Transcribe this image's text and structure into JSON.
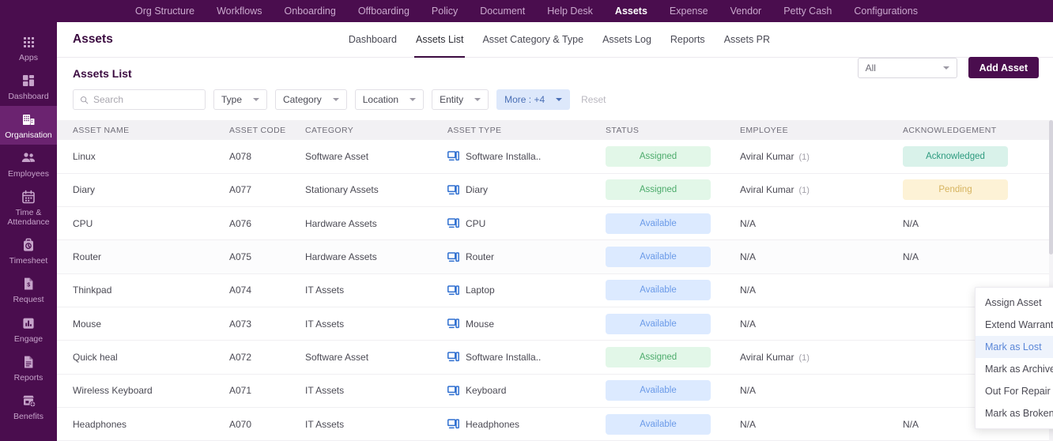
{
  "topnav": {
    "items": [
      {
        "label": "Org Structure",
        "active": false
      },
      {
        "label": "Workflows",
        "active": false
      },
      {
        "label": "Onboarding",
        "active": false
      },
      {
        "label": "Offboarding",
        "active": false
      },
      {
        "label": "Policy",
        "active": false
      },
      {
        "label": "Document",
        "active": false
      },
      {
        "label": "Help Desk",
        "active": false
      },
      {
        "label": "Assets",
        "active": true
      },
      {
        "label": "Expense",
        "active": false
      },
      {
        "label": "Vendor",
        "active": false
      },
      {
        "label": "Petty Cash",
        "active": false
      },
      {
        "label": "Configurations",
        "active": false
      }
    ]
  },
  "sidebar": {
    "items": [
      {
        "label": "Apps",
        "icon": "grid-icon",
        "active": false
      },
      {
        "label": "Dashboard",
        "icon": "dashboard-icon",
        "active": false
      },
      {
        "label": "Organisation",
        "icon": "building-icon",
        "active": true
      },
      {
        "label": "Employees",
        "icon": "people-icon",
        "active": false
      },
      {
        "label": "Time & Attendance",
        "icon": "calendar-icon",
        "active": false
      },
      {
        "label": "Timesheet",
        "icon": "clock-bag-icon",
        "active": false
      },
      {
        "label": "Request",
        "icon": "money-doc-icon",
        "active": false
      },
      {
        "label": "Engage",
        "icon": "bar-chart-icon",
        "active": false
      },
      {
        "label": "Reports",
        "icon": "document-icon",
        "active": false
      },
      {
        "label": "Benefits",
        "icon": "store-plus-icon",
        "active": false
      }
    ]
  },
  "header": {
    "title": "Assets",
    "subnav": [
      {
        "label": "Dashboard",
        "active": false
      },
      {
        "label": "Assets List",
        "active": true
      },
      {
        "label": "Asset Category & Type",
        "active": false
      },
      {
        "label": "Assets Log",
        "active": false
      },
      {
        "label": "Reports",
        "active": false
      },
      {
        "label": "Assets PR",
        "active": false
      }
    ]
  },
  "toolbar": {
    "title": "Assets List",
    "search_placeholder": "Search",
    "search_value": "",
    "search_icon": "search-icon",
    "filters": [
      {
        "label": "Type"
      },
      {
        "label": "Category"
      },
      {
        "label": "Location"
      },
      {
        "label": "Entity"
      }
    ],
    "more_filter": "More : +4",
    "reset_label": "Reset",
    "scope_select": "All",
    "add_button": "Add Asset"
  },
  "table": {
    "columns": [
      "ASSET NAME",
      "ASSET CODE",
      "CATEGORY",
      "ASSET TYPE",
      "STATUS",
      "EMPLOYEE",
      "ACKNOWLEDGEMENT"
    ],
    "rows": [
      {
        "name": "Linux",
        "code": "A078",
        "category": "Software Asset",
        "type": "Software Installa..",
        "type_icon": "monitor-icon",
        "status": "Assigned",
        "status_kind": "assigned",
        "employee": "Aviral Kumar",
        "employee_count": "(1)",
        "ack": "Acknowledged",
        "ack_kind": "ack",
        "hovered": false
      },
      {
        "name": "Diary",
        "code": "A077",
        "category": "Stationary Assets",
        "type": "Diary",
        "type_icon": "monitor-icon",
        "status": "Assigned",
        "status_kind": "assigned",
        "employee": "Aviral Kumar",
        "employee_count": "(1)",
        "ack": "Pending",
        "ack_kind": "pending",
        "hovered": false
      },
      {
        "name": "CPU",
        "code": "A076",
        "category": "Hardware Assets",
        "type": "CPU",
        "type_icon": "monitor-icon",
        "status": "Available",
        "status_kind": "available",
        "employee": "N/A",
        "employee_count": "",
        "ack": "N/A",
        "ack_kind": "na",
        "hovered": false
      },
      {
        "name": "Router",
        "code": "A075",
        "category": "Hardware Assets",
        "type": "Router",
        "type_icon": "monitor-icon",
        "status": "Available",
        "status_kind": "available",
        "employee": "N/A",
        "employee_count": "",
        "ack": "N/A",
        "ack_kind": "na",
        "hovered": true
      },
      {
        "name": "Thinkpad",
        "code": "A074",
        "category": "IT Assets",
        "type": "Laptop",
        "type_icon": "monitor-icon",
        "status": "Available",
        "status_kind": "available",
        "employee": "N/A",
        "employee_count": "",
        "ack": "",
        "ack_kind": "blank",
        "hovered": false
      },
      {
        "name": "Mouse",
        "code": "A073",
        "category": "IT Assets",
        "type": "Mouse",
        "type_icon": "monitor-icon",
        "status": "Available",
        "status_kind": "available",
        "employee": "N/A",
        "employee_count": "",
        "ack": "",
        "ack_kind": "blank",
        "hovered": false
      },
      {
        "name": "Quick heal",
        "code": "A072",
        "category": "Software Asset",
        "type": "Software Installa..",
        "type_icon": "monitor-icon",
        "status": "Assigned",
        "status_kind": "assigned",
        "employee": "Aviral Kumar",
        "employee_count": "(1)",
        "ack": "",
        "ack_kind": "blank",
        "hovered": false
      },
      {
        "name": "Wireless Keyboard",
        "code": "A071",
        "category": "IT Assets",
        "type": "Keyboard",
        "type_icon": "monitor-icon",
        "status": "Available",
        "status_kind": "available",
        "employee": "N/A",
        "employee_count": "",
        "ack": "",
        "ack_kind": "blank",
        "hovered": false
      },
      {
        "name": "Headphones",
        "code": "A070",
        "category": "IT Assets",
        "type": "Headphones",
        "type_icon": "monitor-icon",
        "status": "Available",
        "status_kind": "available",
        "employee": "N/A",
        "employee_count": "",
        "ack": "N/A",
        "ack_kind": "na",
        "hovered": false
      }
    ]
  },
  "context_menu": {
    "items": [
      {
        "label": "Assign Asset",
        "highlight": false
      },
      {
        "label": "Extend Warranty",
        "highlight": false
      },
      {
        "label": "Mark as Lost",
        "highlight": true
      },
      {
        "label": "Mark as Archived",
        "highlight": false
      },
      {
        "label": "Out For Repair",
        "highlight": false
      },
      {
        "label": "Mark as Broken-Not Fixable",
        "highlight": false
      }
    ]
  },
  "colors": {
    "brand_purple": "#4a0d4e",
    "sidebar_active": "#6b2370",
    "assigned_badge_bg": "#e2f7e8",
    "assigned_badge_fg": "#4cab6b",
    "available_badge_bg": "#dceaff",
    "available_badge_fg": "#6a9ae8",
    "acknowledged_badge_bg": "#d9f2ea",
    "acknowledged_badge_fg": "#2e9b7f",
    "pending_badge_bg": "#fdf2d6",
    "pending_badge_fg": "#d6b35e",
    "more_filter_bg": "#dde8fb",
    "more_filter_fg": "#4a6fb5",
    "type_icon_blue": "#2f6fd0"
  }
}
